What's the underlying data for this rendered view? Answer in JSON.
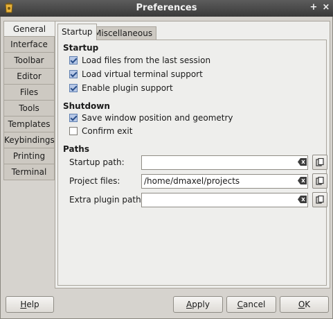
{
  "window": {
    "title": "Preferences",
    "plus_glyph": "+",
    "close_glyph": "×"
  },
  "sidebar": {
    "items": [
      {
        "label": "General",
        "active": true
      },
      {
        "label": "Interface",
        "active": false
      },
      {
        "label": "Toolbar",
        "active": false
      },
      {
        "label": "Editor",
        "active": false
      },
      {
        "label": "Files",
        "active": false
      },
      {
        "label": "Tools",
        "active": false
      },
      {
        "label": "Templates",
        "active": false
      },
      {
        "label": "Keybindings",
        "active": false
      },
      {
        "label": "Printing",
        "active": false
      },
      {
        "label": "Terminal",
        "active": false
      }
    ]
  },
  "tabs": [
    {
      "label": "Startup",
      "active": true
    },
    {
      "label": "Miscellaneous",
      "active": false
    }
  ],
  "startup": {
    "heading": "Startup",
    "options": [
      {
        "label": "Load files from the last session",
        "checked": true
      },
      {
        "label": "Load virtual terminal support",
        "checked": true
      },
      {
        "label": "Enable plugin support",
        "checked": true
      }
    ]
  },
  "shutdown": {
    "heading": "Shutdown",
    "options": [
      {
        "label": "Save window position and geometry",
        "checked": true
      },
      {
        "label": "Confirm exit",
        "checked": false
      }
    ]
  },
  "paths": {
    "heading": "Paths",
    "rows": [
      {
        "label": "Startup path:",
        "value": ""
      },
      {
        "label": "Project files:",
        "value": "/home/dmaxel/projects"
      },
      {
        "label": "Extra plugin path:",
        "value": ""
      }
    ]
  },
  "buttons": {
    "help_first": "H",
    "help_rest": "elp",
    "apply_first": "A",
    "apply_rest": "pply",
    "cancel_first": "C",
    "cancel_rest": "ancel",
    "ok_first": "O",
    "ok_rest": "K"
  },
  "colors": {
    "titlebar": "#3a3a3a",
    "panel": "#eeeeec",
    "window_bg": "#d6d3ce",
    "check_accent": "#2a4f8a"
  }
}
